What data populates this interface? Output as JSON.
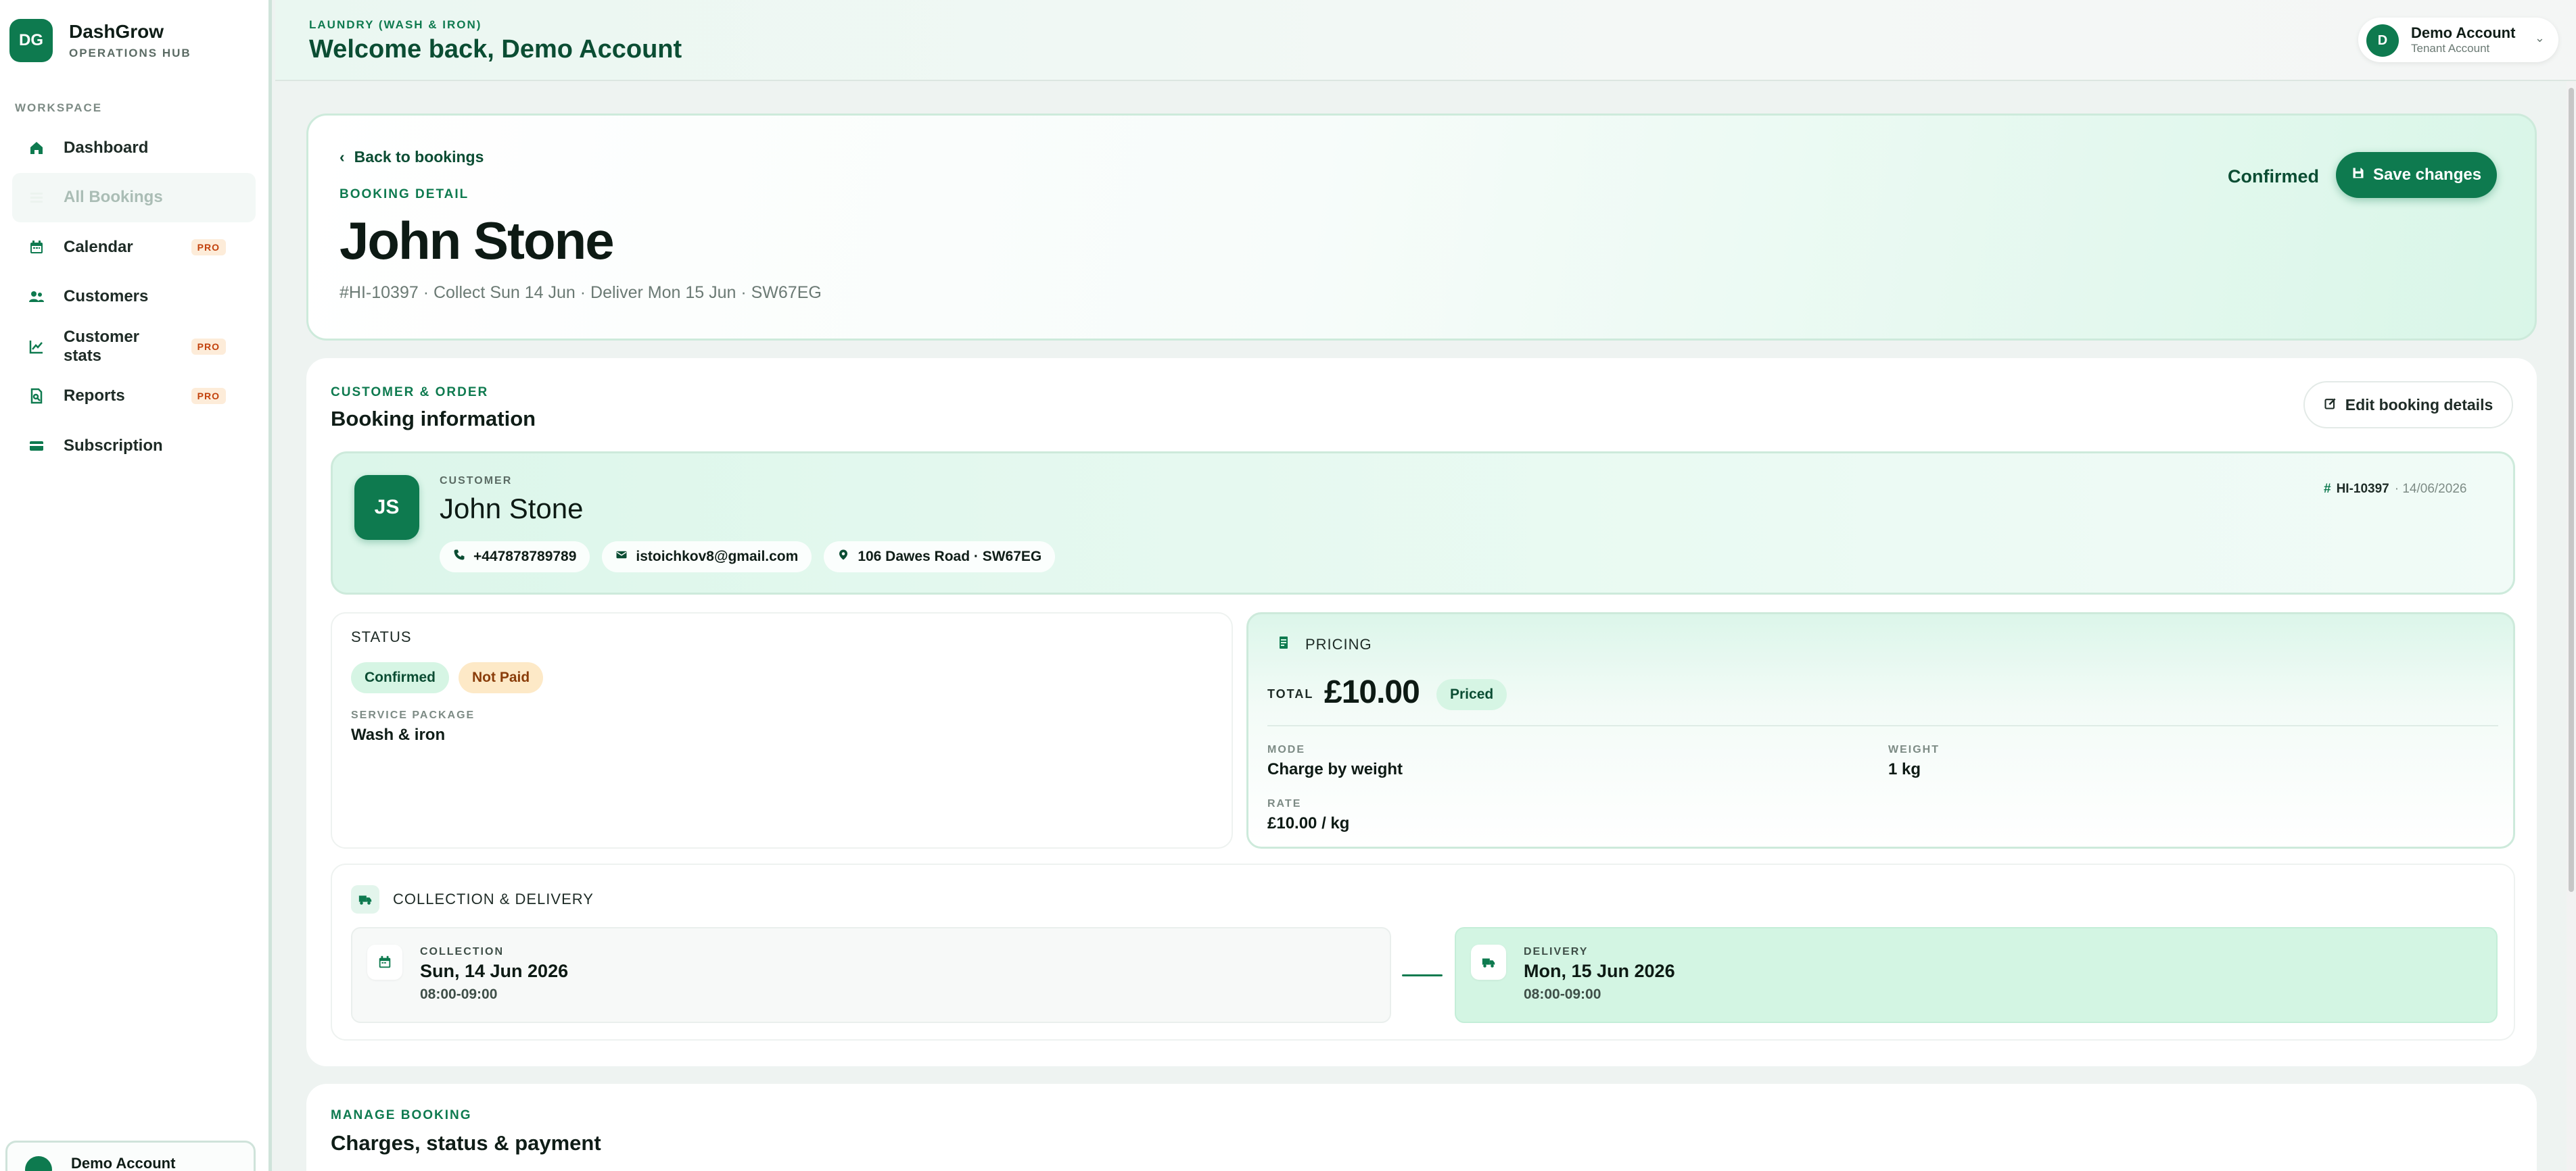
{
  "brand": {
    "logo": "DG",
    "name": "DashGrow",
    "subtitle": "OPERATIONS HUB"
  },
  "sidebar": {
    "section_label": "WORKSPACE",
    "items": [
      {
        "label": "Dashboard",
        "icon": "home-icon",
        "pro": ""
      },
      {
        "label": "All Bookings",
        "icon": "list-icon",
        "pro": "",
        "active": true
      },
      {
        "label": "Calendar",
        "icon": "calendar-icon",
        "pro": "PRO"
      },
      {
        "label": "Customers",
        "icon": "users-icon",
        "pro": ""
      },
      {
        "label": "Customer stats",
        "icon": "chart-line-icon",
        "pro": "PRO"
      },
      {
        "label": "Reports",
        "icon": "report-icon",
        "pro": "PRO"
      },
      {
        "label": "Subscription",
        "icon": "card-icon",
        "pro": ""
      }
    ],
    "account_name": "Demo Account"
  },
  "header": {
    "tag": "LAUNDRY (WASH & IRON)",
    "welcome": "Welcome back, Demo Account",
    "user": {
      "initial": "D",
      "name": "Demo Account",
      "role": "Tenant Account"
    }
  },
  "hero": {
    "back_label": "Back to bookings",
    "eyebrow": "BOOKING DETAIL",
    "title": "John Stone",
    "meta": "#HI-10397 · Collect Sun 14 Jun · Deliver Mon 15 Jun · SW67EG",
    "status": "Confirmed",
    "save_label": "Save changes"
  },
  "info": {
    "eyebrow": "CUSTOMER & ORDER",
    "title": "Booking information",
    "edit_label": "Edit booking details",
    "customer": {
      "initials": "JS",
      "label": "CUSTOMER",
      "name": "John Stone",
      "phone": "+447878789789",
      "email": "istoichkov8@gmail.com",
      "address": "106 Dawes Road · SW67EG",
      "ref": "HI-10397",
      "date": "· 14/06/2026"
    },
    "status": {
      "label": "STATUS",
      "badge_status": "Confirmed",
      "badge_payment": "Not Paid",
      "package_label": "SERVICE PACKAGE",
      "package_value": "Wash & iron"
    },
    "pricing": {
      "label": "PRICING",
      "total_label": "TOTAL",
      "total": "£10.00",
      "priced_badge": "Priced",
      "mode_label": "MODE",
      "mode_value": "Charge by weight",
      "weight_label": "WEIGHT",
      "weight_value": "1 kg",
      "rate_label": "RATE",
      "rate_value": "£10.00 / kg"
    },
    "delivery": {
      "label": "COLLECTION & DELIVERY",
      "collection_label": "COLLECTION",
      "collection_date": "Sun, 14 Jun 2026",
      "collection_time": "08:00-09:00",
      "delivery_label": "DELIVERY",
      "delivery_date": "Mon, 15 Jun 2026",
      "delivery_time": "08:00-09:00"
    }
  },
  "manage": {
    "eyebrow": "MANAGE BOOKING",
    "title": "Charges, status & payment"
  },
  "colors": {
    "brand": "#0e7a4f",
    "brand_dark": "#0b4d33",
    "mint": "#d6f5e4",
    "pro": "#c2410c"
  }
}
